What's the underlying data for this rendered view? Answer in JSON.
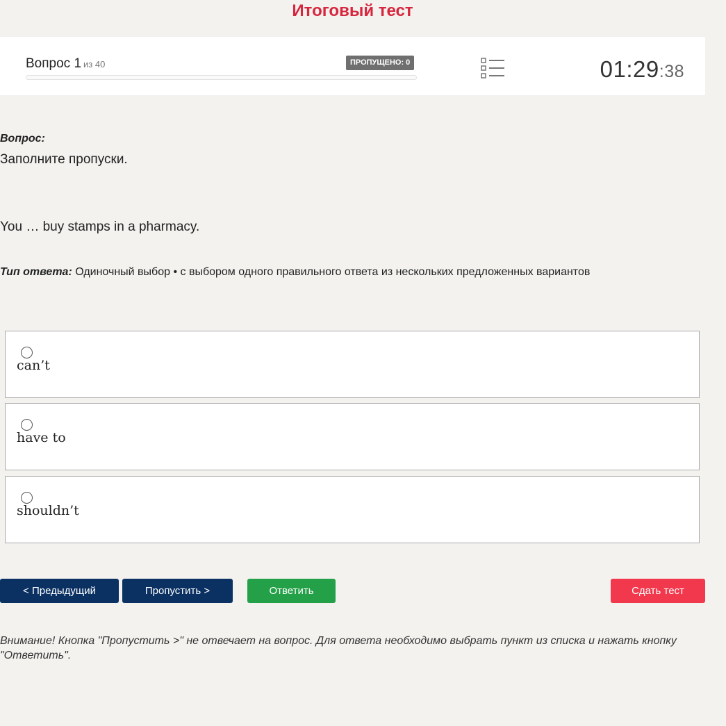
{
  "page": {
    "title": "Итоговый тест"
  },
  "header": {
    "question_label": "Вопрос 1",
    "question_of": "из 40",
    "skipped_badge": "ПРОПУЩЕНО: 0",
    "timer_main": "01:29",
    "timer_sep": ":",
    "timer_seconds": "38",
    "progress": 0
  },
  "question": {
    "label": "Вопрос:",
    "instruction": "Заполните пропуски.",
    "sentence": "You … buy stamps in a pharmacy.",
    "answer_type_label": "Тип ответа:",
    "answer_type_value": "Одиночный выбор • с выбором одного правильного ответа из нескольких предложенных вариантов"
  },
  "options": [
    {
      "text": "can’t"
    },
    {
      "text": "have to"
    },
    {
      "text": "shouldn’t"
    }
  ],
  "buttons": {
    "prev": "< Предыдущий",
    "skip": "Пропустить >",
    "answer": "Ответить",
    "submit": "Сдать тест"
  },
  "warning": "Внимание! Кнопка \"Пропустить >\" не отвечает на вопрос. Для ответа необходимо выбрать пункт из списка и нажать кнопку \"Ответить\".",
  "colors": {
    "title": "#d7263d",
    "primary_button": "#0b3163",
    "answer_button": "#24a148",
    "submit_button": "#f2384d",
    "badge": "#6f6f6f"
  },
  "icons": {
    "question_list": "list-icon"
  }
}
